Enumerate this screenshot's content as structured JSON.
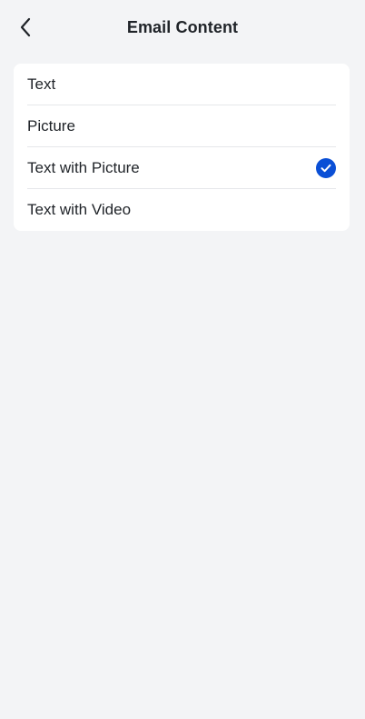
{
  "header": {
    "title": "Email Content",
    "back_icon": "chevron-left-icon"
  },
  "options": [
    {
      "label": "Text",
      "selected": false
    },
    {
      "label": "Picture",
      "selected": false
    },
    {
      "label": "Text with Picture",
      "selected": true
    },
    {
      "label": "Text with Video",
      "selected": false
    }
  ],
  "colors": {
    "background": "#f3f4f6",
    "card": "#ffffff",
    "accent": "#0a4fd6",
    "divider": "#e6e7ea",
    "text": "#1f2328"
  }
}
